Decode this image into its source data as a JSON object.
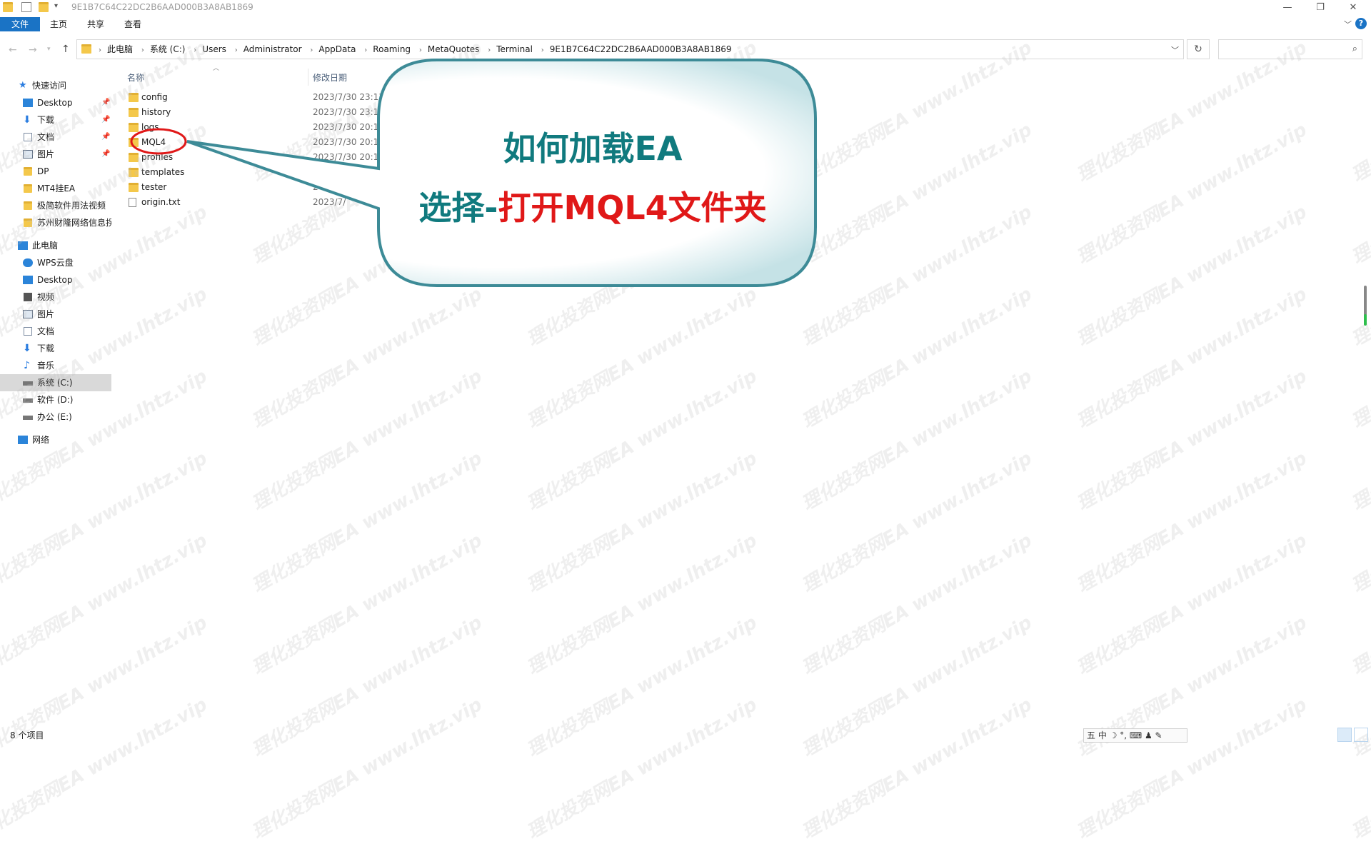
{
  "window": {
    "title": "9E1B7C64C22DC2B6AAD000B3A8AB1869",
    "minimize": "—",
    "restore": "❐",
    "close": "✕"
  },
  "ribbon": {
    "tabs": [
      "文件",
      "主页",
      "共享",
      "查看"
    ],
    "help": "?"
  },
  "address": {
    "crumbs": [
      "此电脑",
      "系统 (C:)",
      "Users",
      "Administrator",
      "AppData",
      "Roaming",
      "MetaQuotes",
      "Terminal",
      "9E1B7C64C22DC2B6AAD000B3A8AB1869"
    ],
    "search_placeholder": ""
  },
  "nav": {
    "quick_access": "快速访问",
    "quick_items": [
      "Desktop",
      "下载",
      "文档",
      "图片",
      "DP",
      "MT4挂EA",
      "极简软件用法视频",
      "苏州财隆网络信息拐"
    ],
    "this_pc": "此电脑",
    "pc_items": [
      "WPS云盘",
      "Desktop",
      "视频",
      "图片",
      "文档",
      "下载",
      "音乐",
      "系统 (C:)",
      "软件 (D:)",
      "办公 (E:)"
    ],
    "network": "网络"
  },
  "columns": {
    "name": "名称",
    "date": "修改日期"
  },
  "files": [
    {
      "name": "config",
      "date": "2023/7/30 23:13",
      "type": "folder"
    },
    {
      "name": "history",
      "date": "2023/7/30 23:13",
      "type": "folder"
    },
    {
      "name": "logs",
      "date": "2023/7/30 20:15",
      "type": "folder"
    },
    {
      "name": "MQL4",
      "date": "2023/7/30 20:15",
      "type": "folder"
    },
    {
      "name": "profiles",
      "date": "2023/7/30 20:15",
      "type": "folder"
    },
    {
      "name": "templates",
      "date": "",
      "type": "folder"
    },
    {
      "name": "tester",
      "date": "2",
      "type": "folder"
    },
    {
      "name": "origin.txt",
      "date": "2023/7/",
      "type": "txt"
    }
  ],
  "callout": {
    "title": "如何加载EA",
    "sub_prefix": "选择-",
    "sub_highlight": "打开MQL4文件夹"
  },
  "status": {
    "item_count": "8 个项目",
    "ime": "五 中 ☽ °, ⌨ ♟ ✎"
  },
  "watermark": "理化投资网EA  www.lhtz.vip",
  "colors": {
    "accent": "#1a73c5",
    "callout_teal": "#107a7e",
    "callout_red": "#e01818",
    "circle_red": "#e01818"
  }
}
